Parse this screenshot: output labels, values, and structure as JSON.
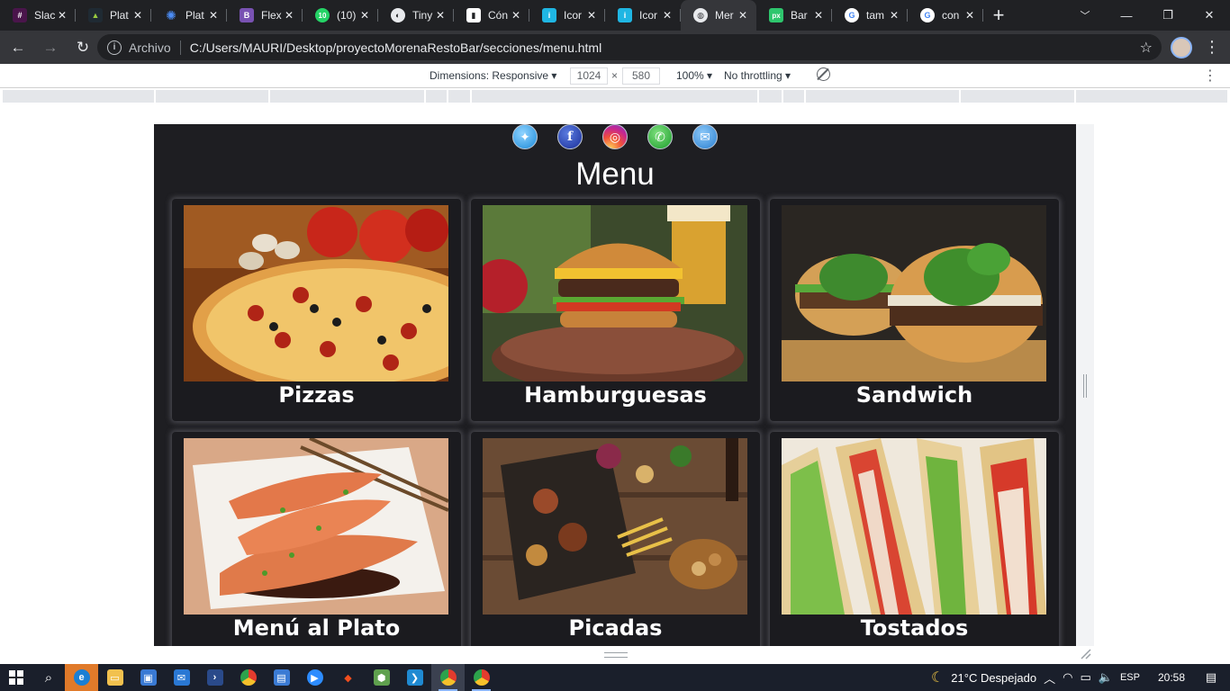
{
  "browser": {
    "tabs": [
      {
        "title": "Slac",
        "icon": "slack-icon",
        "color": "#e01e5a"
      },
      {
        "title": "Plat",
        "icon": "platzi-icon",
        "color": "#98ca3f"
      },
      {
        "title": "Plat",
        "icon": "platzi-bug-icon",
        "color": "#2d6ee6"
      },
      {
        "title": "Flex",
        "icon": "bootstrap-icon",
        "color": "#7952b3"
      },
      {
        "title": "(10)",
        "icon": "whatsapp-icon",
        "color": "#25d366"
      },
      {
        "title": "Tiny",
        "icon": "tinypng-icon",
        "color": "#dcdcdc"
      },
      {
        "title": "Cón",
        "icon": "bookmark-icon",
        "color": "#ffffff"
      },
      {
        "title": "Icor",
        "icon": "iconfinder-icon",
        "color": "#1fb6e3"
      },
      {
        "title": "Icor",
        "icon": "iconfinder-icon",
        "color": "#1fb6e3"
      },
      {
        "title": "Mer",
        "icon": "globe-icon",
        "color": "#9aa0a6",
        "active": true
      },
      {
        "title": "Bar",
        "icon": "pixabay-icon",
        "color": "#2ec66d"
      },
      {
        "title": "tam",
        "icon": "google-icon",
        "color": "#4285f4"
      },
      {
        "title": "con",
        "icon": "google-icon",
        "color": "#4285f4"
      }
    ],
    "new_tab_symbol": "+",
    "omnibox": {
      "scheme_label": "Archivo",
      "url": "C:/Users/MAURI/Desktop/proyectoMorenaRestoBar/secciones/menu.html"
    }
  },
  "devtools": {
    "dimensions_label": "Dimensions: Responsive ▾",
    "width": "1024",
    "times": "×",
    "height": "580",
    "zoom": "100% ▾",
    "throttling": "No throttling ▾"
  },
  "site": {
    "title": "Menu",
    "social": [
      {
        "name": "twitter",
        "glyph": "✦"
      },
      {
        "name": "facebook",
        "glyph": "f"
      },
      {
        "name": "instagram",
        "glyph": "◎"
      },
      {
        "name": "whatsapp",
        "glyph": "✆"
      },
      {
        "name": "mail",
        "glyph": "✉"
      }
    ],
    "items": [
      {
        "label": "Pizzas"
      },
      {
        "label": "Hamburguesas"
      },
      {
        "label": "Sandwich"
      },
      {
        "label": "Menú al Plato"
      },
      {
        "label": "Picadas"
      },
      {
        "label": "Tostados"
      }
    ]
  },
  "taskbar": {
    "weather": "21°C  Despejado",
    "language": "ESP",
    "clock": "20:58"
  }
}
